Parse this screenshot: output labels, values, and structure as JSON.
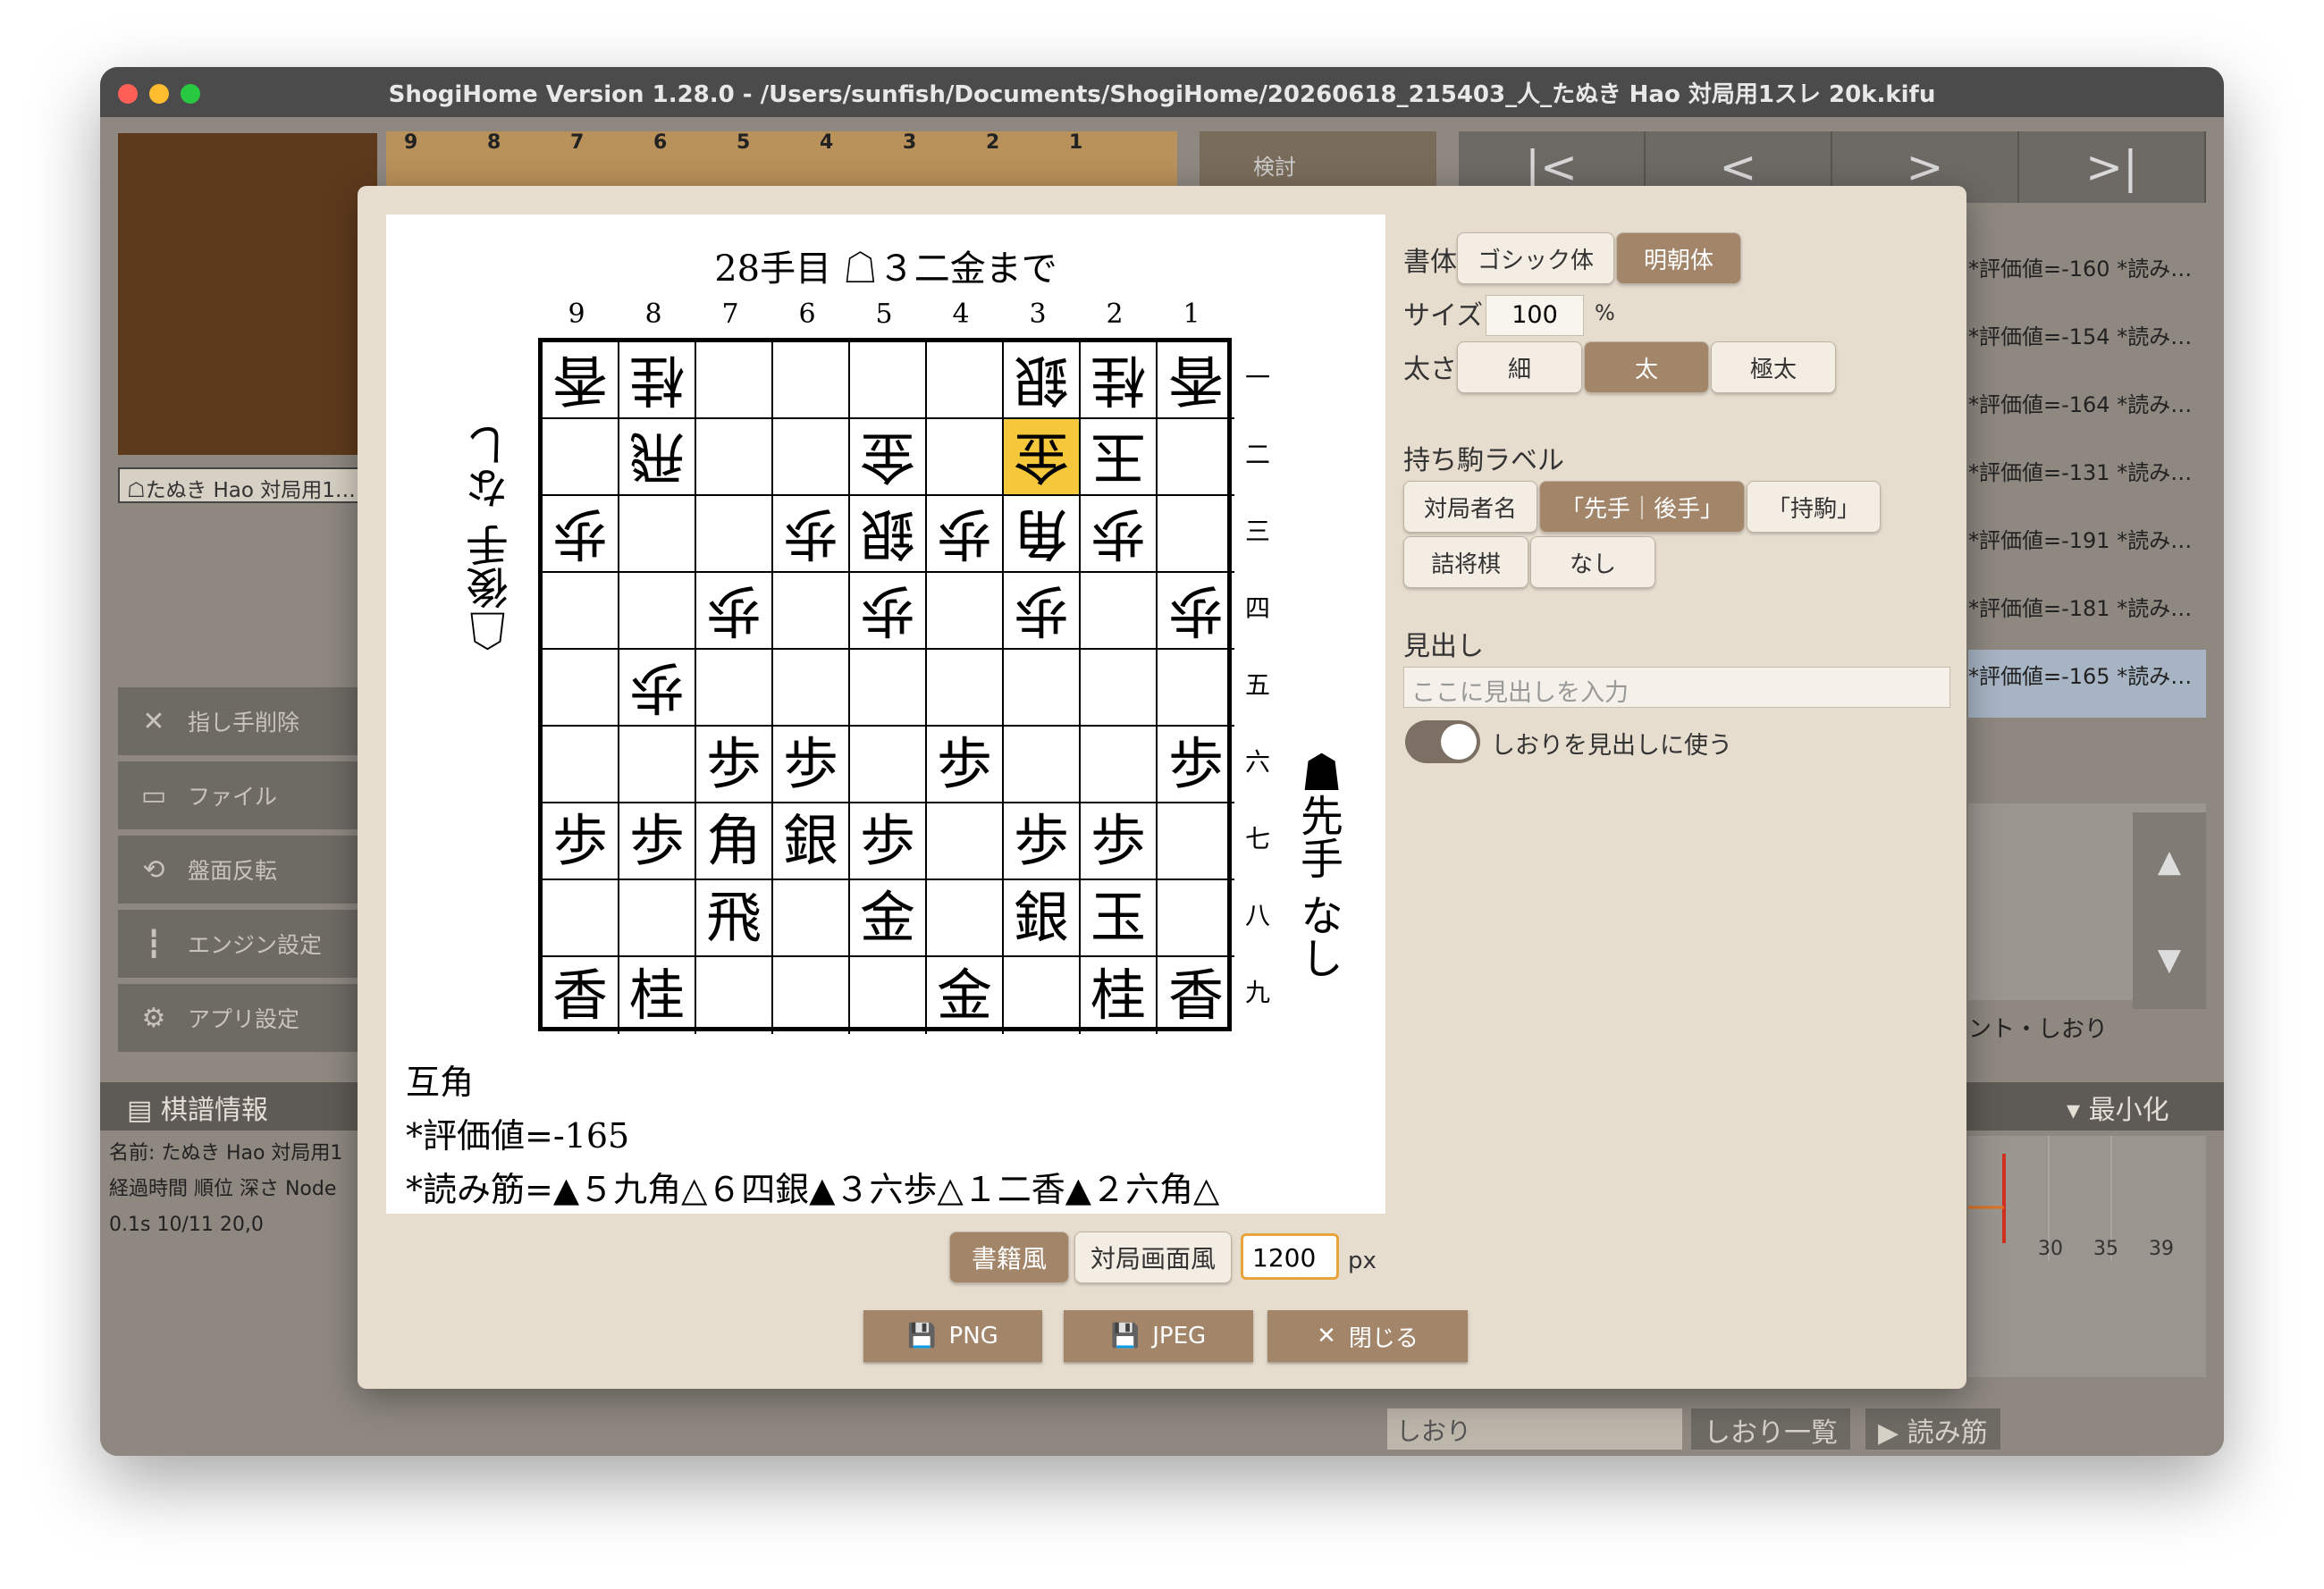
{
  "window": {
    "title": "ShogiHome Version 1.28.0 - /Users/sunfish/Documents/ShogiHome/20260618_215403_人_たぬき Hao 対局用1スレ 20k.kifu"
  },
  "background": {
    "hand_label": "☖たぬき Hao 対局用1…",
    "board_col_numbers": [
      "9",
      "8",
      "7",
      "6",
      "5",
      "4",
      "3",
      "2",
      "1"
    ],
    "tab_label": "検討",
    "nav": [
      "|<",
      "<",
      ">",
      ">|"
    ],
    "sidebar": [
      {
        "icon": "✕",
        "label": "指し手削除"
      },
      {
        "icon": "▭",
        "label": "ファイル"
      },
      {
        "icon": "⟲",
        "label": "盤面反転"
      },
      {
        "icon": "┇",
        "label": "エンジン設定"
      },
      {
        "icon": "⚙",
        "label": "アプリ設定"
      }
    ],
    "records": [
      "*評価値=-160 *読み…",
      "*評価値=-154 *読み…",
      "*評価値=-164 *読み…",
      "*評価値=-131 *読み…",
      "*評価値=-191 *読み…",
      "*評価値=-181 *読み…",
      "*評価値=-165 *読み…"
    ],
    "comment_label": "ント・しおり",
    "kifu_info": "棋譜情報",
    "minimize": "最小化",
    "info_lines": [
      "名前: たぬき Hao 対局用1",
      "経過時間 順位 深さ Node",
      "0.1s 10/11 20,0"
    ],
    "graph_ticks": [
      "30",
      "35",
      "39"
    ],
    "bookmark_placeholder": "しおり",
    "bookmark_list": "しおり一覧",
    "pv_button": "▶ 読み筋"
  },
  "dialog": {
    "preview": {
      "title": "28手目 ☖３二金まで",
      "col_numbers": [
        "9",
        "8",
        "7",
        "6",
        "5",
        "4",
        "3",
        "2",
        "1"
      ],
      "row_numbers": [
        "一",
        "二",
        "三",
        "四",
        "五",
        "六",
        "七",
        "八",
        "九"
      ],
      "board": [
        [
          {
            "p": "香",
            "g": true
          },
          {
            "p": "桂",
            "g": true
          },
          {
            "p": ""
          },
          {
            "p": ""
          },
          {
            "p": ""
          },
          {
            "p": ""
          },
          {
            "p": "銀",
            "g": true
          },
          {
            "p": "桂",
            "g": true
          },
          {
            "p": "香",
            "g": true
          }
        ],
        [
          {
            "p": ""
          },
          {
            "p": "飛",
            "g": true
          },
          {
            "p": ""
          },
          {
            "p": ""
          },
          {
            "p": "金",
            "g": true
          },
          {
            "p": ""
          },
          {
            "p": "金",
            "g": true,
            "hl": true
          },
          {
            "p": "玉",
            "g": true
          },
          {
            "p": ""
          }
        ],
        [
          {
            "p": "歩",
            "g": true
          },
          {
            "p": ""
          },
          {
            "p": ""
          },
          {
            "p": "歩",
            "g": true
          },
          {
            "p": "銀",
            "g": true
          },
          {
            "p": "歩",
            "g": true
          },
          {
            "p": "角",
            "g": true
          },
          {
            "p": "歩",
            "g": true
          },
          {
            "p": ""
          }
        ],
        [
          {
            "p": ""
          },
          {
            "p": ""
          },
          {
            "p": "歩",
            "g": true
          },
          {
            "p": ""
          },
          {
            "p": "歩",
            "g": true
          },
          {
            "p": ""
          },
          {
            "p": "歩",
            "g": true
          },
          {
            "p": ""
          },
          {
            "p": "歩",
            "g": true
          }
        ],
        [
          {
            "p": ""
          },
          {
            "p": "歩",
            "g": true
          },
          {
            "p": ""
          },
          {
            "p": ""
          },
          {
            "p": ""
          },
          {
            "p": ""
          },
          {
            "p": ""
          },
          {
            "p": ""
          },
          {
            "p": ""
          }
        ],
        [
          {
            "p": ""
          },
          {
            "p": ""
          },
          {
            "p": "歩"
          },
          {
            "p": "歩"
          },
          {
            "p": ""
          },
          {
            "p": "歩"
          },
          {
            "p": ""
          },
          {
            "p": ""
          },
          {
            "p": "歩"
          }
        ],
        [
          {
            "p": "歩"
          },
          {
            "p": "歩"
          },
          {
            "p": "角"
          },
          {
            "p": "銀"
          },
          {
            "p": "歩"
          },
          {
            "p": ""
          },
          {
            "p": "歩"
          },
          {
            "p": "歩"
          },
          {
            "p": ""
          }
        ],
        [
          {
            "p": ""
          },
          {
            "p": ""
          },
          {
            "p": "飛"
          },
          {
            "p": ""
          },
          {
            "p": "金"
          },
          {
            "p": ""
          },
          {
            "p": "銀"
          },
          {
            "p": "玉"
          },
          {
            "p": ""
          }
        ],
        [
          {
            "p": "香"
          },
          {
            "p": "桂"
          },
          {
            "p": ""
          },
          {
            "p": ""
          },
          {
            "p": ""
          },
          {
            "p": "金"
          },
          {
            "p": ""
          },
          {
            "p": "桂"
          },
          {
            "p": "香"
          }
        ]
      ],
      "hand_gote": "☖後手 なし",
      "hand_sente": "☗先手 なし",
      "opening": "互角",
      "eval": "*評価値=-165",
      "pv": "*読み筋=▲５九角△６四銀▲３六歩△１二香▲２六角△"
    },
    "font_label": "書体",
    "font_options": [
      {
        "label": "ゴシック体",
        "on": false
      },
      {
        "label": "明朝体",
        "on": true
      }
    ],
    "size_label": "サイズ",
    "size_value": "100",
    "size_unit": "%",
    "weight_label": "太さ",
    "weight_options": [
      {
        "label": "細",
        "on": false
      },
      {
        "label": "太",
        "on": true
      },
      {
        "label": "極太",
        "on": false
      }
    ],
    "hand_label_title": "持ち駒ラベル",
    "hand_label_options": [
      {
        "label": "対局者名",
        "on": false
      },
      {
        "label": "「先手｜後手」",
        "on": true
      },
      {
        "label": "「持駒」",
        "on": false
      },
      {
        "label": "詰将棋",
        "on": false
      },
      {
        "label": "なし",
        "on": false
      }
    ],
    "heading_label": "見出し",
    "heading_placeholder": "ここに見出しを入力",
    "toggle_label": "しおりを見出しに使う",
    "style_options": [
      {
        "label": "書籍風",
        "on": true
      },
      {
        "label": "対局画面風",
        "on": false
      }
    ],
    "px_value": "1200",
    "px_unit": "px",
    "actions": [
      {
        "icon": "💾",
        "label": "PNG"
      },
      {
        "icon": "💾",
        "label": "JPEG"
      },
      {
        "icon": "✕",
        "label": "閉じる"
      }
    ],
    "colors": {
      "accent": "#a3866a",
      "highlight": "#f5c73a",
      "dialog_bg": "#e7ddcf"
    }
  }
}
